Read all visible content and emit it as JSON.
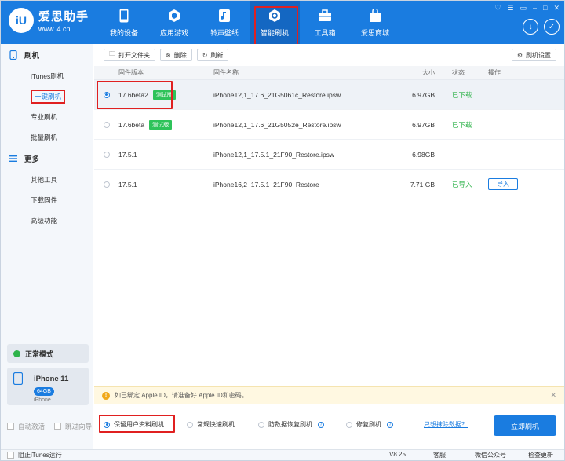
{
  "app": {
    "logo_text": "iU",
    "name": "爱思助手",
    "url": "www.i4.cn"
  },
  "nav": [
    {
      "label": "我的设备",
      "icon": "phone-icon"
    },
    {
      "label": "应用游戏",
      "icon": "apps-icon"
    },
    {
      "label": "铃声壁纸",
      "icon": "ringtone-icon"
    },
    {
      "label": "智能刷机",
      "icon": "flash-icon",
      "active": true
    },
    {
      "label": "工具箱",
      "icon": "toolbox-icon"
    },
    {
      "label": "爱思商城",
      "icon": "shop-icon"
    }
  ],
  "sidebar": {
    "group1": "刷机",
    "items1": [
      "iTunes刷机",
      "一键刷机",
      "专业刷机",
      "批量刷机"
    ],
    "group2": "更多",
    "items2": [
      "其他工具",
      "下载固件",
      "高级功能"
    ],
    "mode": "正常模式",
    "device_name": "iPhone 11",
    "device_capacity": "64GB",
    "device_model": "iPhone",
    "check_auto": "自动激活",
    "check_skip": "跳过向导"
  },
  "toolbar": {
    "open_folder": "打开文件夹",
    "delete": "删除",
    "refresh": "刷新",
    "settings": "刷机设置"
  },
  "table": {
    "headers": [
      "固件版本",
      "固件名称",
      "大小",
      "状态",
      "操作"
    ],
    "rows": [
      {
        "version": "17.6beta2",
        "badge": "测试版",
        "name": "iPhone12,1_17.6_21G5061c_Restore.ipsw",
        "size": "6.97GB",
        "status": "已下载",
        "op": "",
        "selected": true
      },
      {
        "version": "17.6beta",
        "badge": "测试版",
        "name": "iPhone12,1_17.6_21G5052e_Restore.ipsw",
        "size": "6.97GB",
        "status": "已下载",
        "op": ""
      },
      {
        "version": "17.5.1",
        "badge": "",
        "name": "iPhone12,1_17.5.1_21F90_Restore.ipsw",
        "size": "6.98GB",
        "status": "",
        "op": ""
      },
      {
        "version": "17.5.1",
        "badge": "",
        "name": "iPhone16,2_17.5.1_21F90_Restore",
        "size": "7.71 GB",
        "status": "已导入",
        "op": "导入"
      }
    ]
  },
  "notice": "如已绑定 Apple ID，请准备好 Apple ID和密码。",
  "options": {
    "keep": "保留用户资料刷机",
    "quick": "常规快速刷机",
    "recover": "防数据恢复刷机",
    "repair": "修复刷机",
    "link": "只想抹除数据？",
    "flash": "立即刷机"
  },
  "statusbar": {
    "block_itunes": "阻止iTunes运行",
    "version": "V8.25",
    "service": "客服",
    "wechat": "微信公众号",
    "update": "检查更新"
  },
  "colors": {
    "brand": "#1a7ce0",
    "highlight": "#e02020",
    "success": "#2eb34a"
  }
}
